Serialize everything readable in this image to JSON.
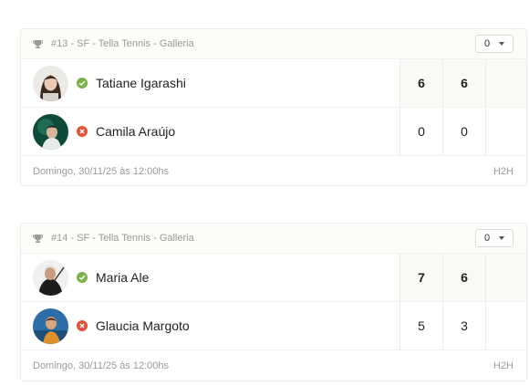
{
  "matches": [
    {
      "event": "#13 - SF - Tella Tennis - Galleria",
      "dropdown_value": "0",
      "players": [
        {
          "name": "Tatiane Igarashi",
          "status": "won",
          "scores": [
            "6",
            "6",
            ""
          ]
        },
        {
          "name": "Camila Araújo",
          "status": "lost",
          "scores": [
            "0",
            "0",
            ""
          ]
        }
      ],
      "datetime": "Domingo, 30/11/25 às 12:00hs",
      "h2h_label": "H2H"
    },
    {
      "event": "#14 - SF - Tella Tennis - Galleria",
      "dropdown_value": "0",
      "players": [
        {
          "name": "Maria Ale",
          "status": "won",
          "scores": [
            "7",
            "6",
            ""
          ]
        },
        {
          "name": "Glaucia Margoto",
          "status": "lost",
          "scores": [
            "5",
            "3",
            ""
          ]
        }
      ],
      "datetime": "Domingo, 30/11/25 às 12:00hs",
      "h2h_label": "H2H"
    }
  ],
  "colors": {
    "win": "#7cb04a",
    "loss": "#e0533a",
    "muted": "#9a9a9a"
  },
  "icons": {
    "trophy": "trophy-icon",
    "win": "check-circle-icon",
    "loss": "x-circle-icon",
    "dropdown": "chevron-down-icon"
  }
}
